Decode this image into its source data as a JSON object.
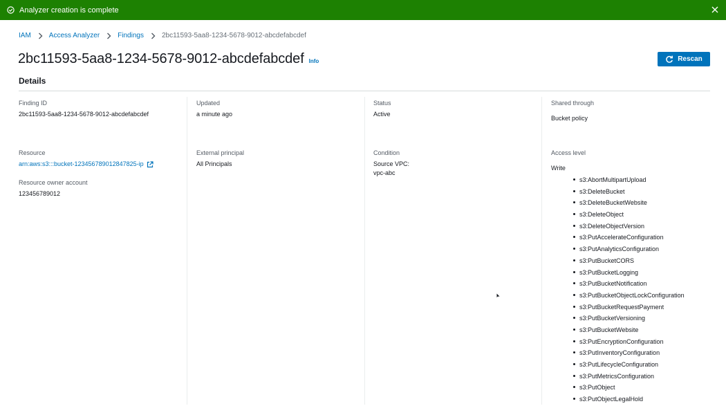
{
  "flash": {
    "message": "Analyzer creation is complete",
    "icon": "check-circle-icon",
    "close_icon": "close-icon",
    "color": "#1d8102"
  },
  "breadcrumb": {
    "items": [
      "IAM",
      "Access Analyzer",
      "Findings"
    ],
    "current": "2bc11593-5aa8-1234-5678-9012-abcdefabcdef"
  },
  "header": {
    "title": "2bc11593-5aa8-1234-5678-9012-abcdefabcdef",
    "info_label": "Info",
    "rescan_label": "Rescan",
    "accent": "#0073bb"
  },
  "details": {
    "heading": "Details",
    "finding_id": {
      "label": "Finding ID",
      "value": "2bc11593-5aa8-1234-5678-9012-abcdefabcdef"
    },
    "updated": {
      "label": "Updated",
      "value": "a minute ago"
    },
    "status": {
      "label": "Status",
      "value": "Active"
    },
    "shared_through": {
      "label": "Shared through",
      "value": "Bucket policy"
    },
    "resource": {
      "label": "Resource",
      "value": "arn:aws:s3:::bucket-123456789012847825-ip"
    },
    "resource_owner": {
      "label": "Resource owner account",
      "value": "123456789012"
    },
    "external_principal": {
      "label": "External principal",
      "value": "All Principals"
    },
    "condition": {
      "label": "Condition",
      "key": "Source VPC:",
      "value": "vpc-abc"
    },
    "access_level": {
      "label": "Access level",
      "level": "Write",
      "actions": [
        "s3:AbortMultipartUpload",
        "s3:DeleteBucket",
        "s3:DeleteBucketWebsite",
        "s3:DeleteObject",
        "s3:DeleteObjectVersion",
        "s3:PutAccelerateConfiguration",
        "s3:PutAnalyticsConfiguration",
        "s3:PutBucketCORS",
        "s3:PutBucketLogging",
        "s3:PutBucketNotification",
        "s3:PutBucketObjectLockConfiguration",
        "s3:PutBucketRequestPayment",
        "s3:PutBucketVersioning",
        "s3:PutBucketWebsite",
        "s3:PutEncryptionConfiguration",
        "s3:PutInventoryConfiguration",
        "s3:PutLifecycleConfiguration",
        "s3:PutMetricsConfiguration",
        "s3:PutObject",
        "s3:PutObjectLegalHold"
      ]
    }
  }
}
